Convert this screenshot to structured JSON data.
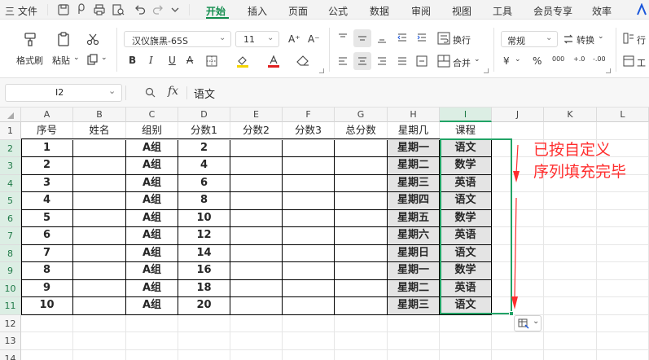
{
  "menubar": {
    "file_label": "三 文件",
    "tabs": [
      "开始",
      "插入",
      "页面",
      "公式",
      "数据",
      "审阅",
      "视图",
      "工具",
      "会员专享",
      "效率"
    ],
    "active_tab": "开始",
    "brand_color": "#138d4e"
  },
  "ribbon": {
    "format_painter": "格式刷",
    "paste": "粘贴",
    "font_name": "汉仪旗黑-65S",
    "font_size": "11",
    "font_grow": "A⁺",
    "font_shrink": "A⁻",
    "bold": "B",
    "italic": "I",
    "underline": "U",
    "strike": "A",
    "wrap_text": "换行",
    "merge": "合并",
    "number_format": "常规",
    "convert": "转换",
    "currency": "¥",
    "percent": "%",
    "thousands": "000",
    "dec_inc": "+.0",
    "dec_dec": "-.00",
    "row_col": "行",
    "worksheet": "工"
  },
  "formula_bar": {
    "name_box": "I2",
    "fx": "fx",
    "content": "语文"
  },
  "sheet": {
    "columns": [
      "A",
      "B",
      "C",
      "D",
      "E",
      "F",
      "G",
      "H",
      "I",
      "J",
      "K",
      "L"
    ],
    "selected_column": "I",
    "row_numbers": [
      "1",
      "2",
      "3",
      "4",
      "5",
      "6",
      "7",
      "8",
      "9",
      "10",
      "11",
      "12",
      "13",
      "14"
    ],
    "headers": [
      "序号",
      "姓名",
      "组别",
      "分数1",
      "分数2",
      "分数3",
      "总分数",
      "星期几",
      "课程"
    ],
    "rows": [
      [
        "1",
        "",
        "A组",
        "2",
        "",
        "",
        "",
        "星期一",
        "语文"
      ],
      [
        "2",
        "",
        "A组",
        "4",
        "",
        "",
        "",
        "星期二",
        "数学"
      ],
      [
        "3",
        "",
        "A组",
        "6",
        "",
        "",
        "",
        "星期三",
        "英语"
      ],
      [
        "4",
        "",
        "A组",
        "8",
        "",
        "",
        "",
        "星期四",
        "语文"
      ],
      [
        "5",
        "",
        "A组",
        "10",
        "",
        "",
        "",
        "星期五",
        "数学"
      ],
      [
        "6",
        "",
        "A组",
        "12",
        "",
        "",
        "",
        "星期六",
        "英语"
      ],
      [
        "7",
        "",
        "A组",
        "14",
        "",
        "",
        "",
        "星期日",
        "语文"
      ],
      [
        "8",
        "",
        "A组",
        "16",
        "",
        "",
        "",
        "星期一",
        "数学"
      ],
      [
        "9",
        "",
        "A组",
        "18",
        "",
        "",
        "",
        "星期二",
        "英语"
      ],
      [
        "10",
        "",
        "A组",
        "20",
        "",
        "",
        "",
        "星期三",
        "语文"
      ]
    ]
  },
  "annotation": {
    "line1": "已按自定义",
    "line2": "序列填充完毕",
    "color": "#ff2d2d"
  },
  "colors": {
    "selection": "#21a366",
    "filled_cell": "#e4e4e4"
  }
}
